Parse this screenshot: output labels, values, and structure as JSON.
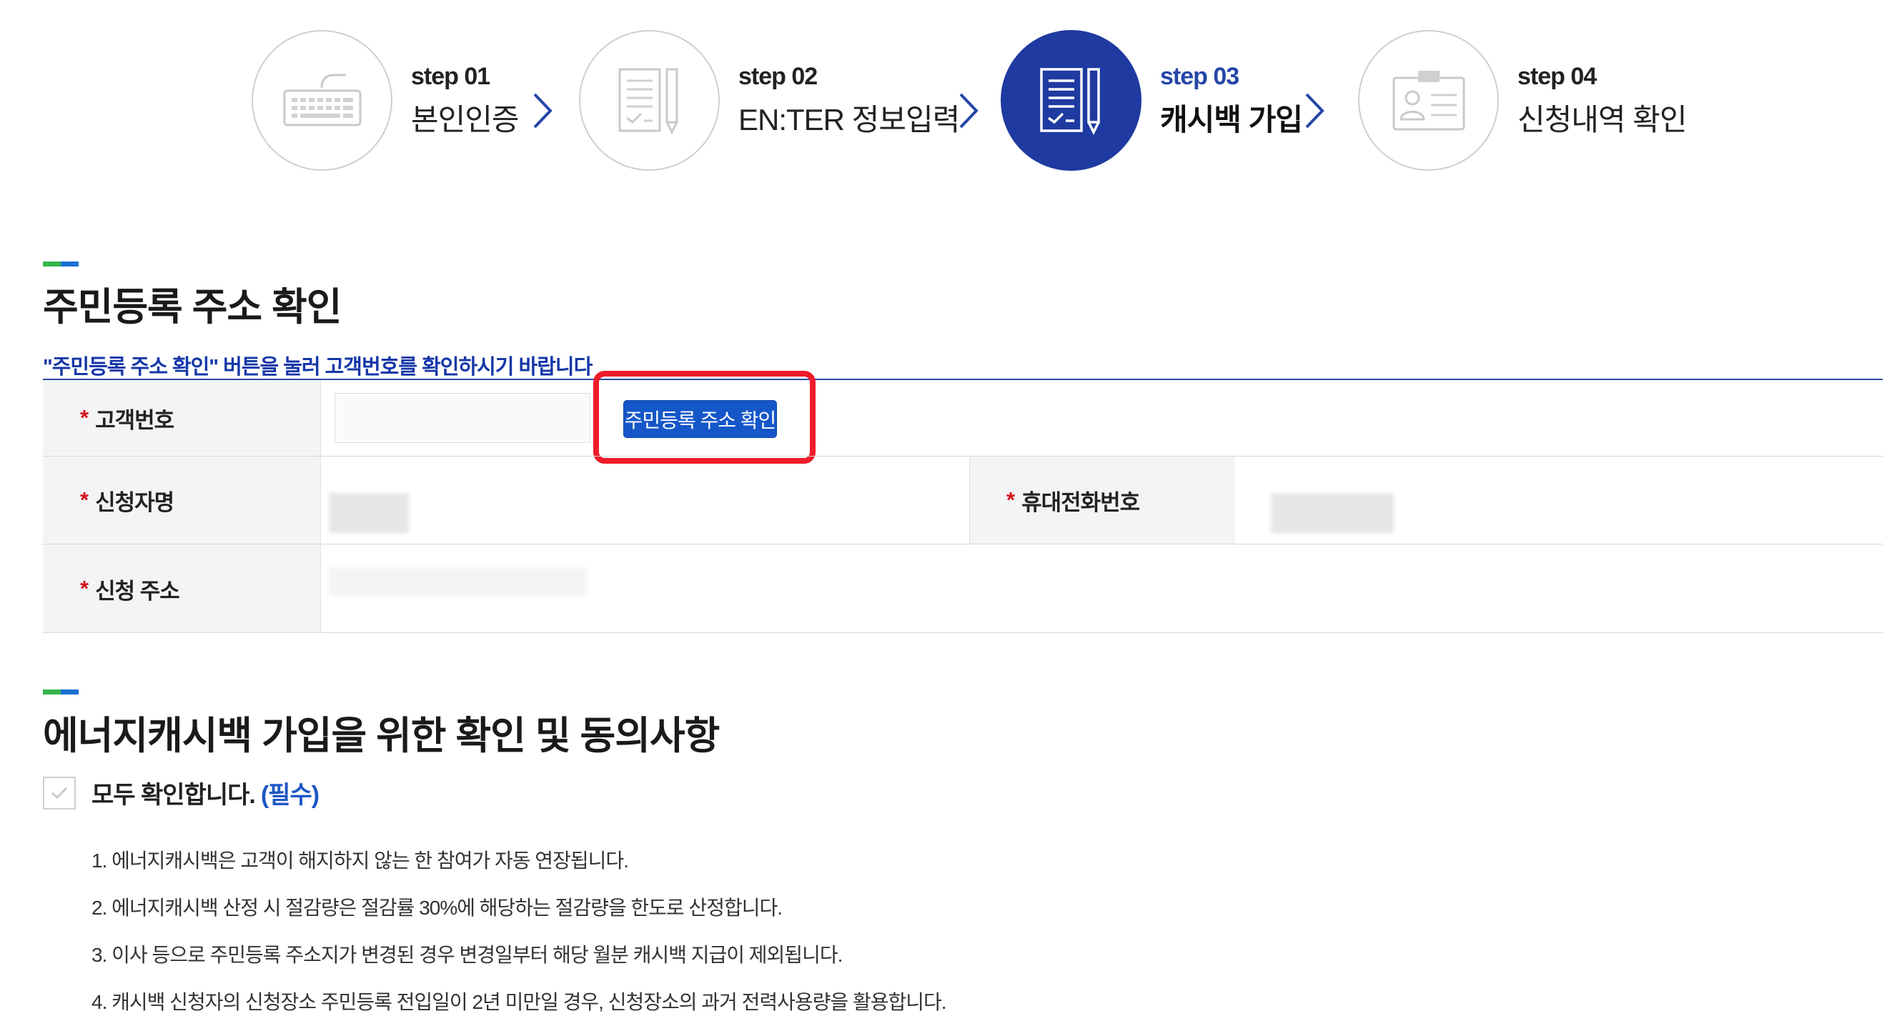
{
  "steps": [
    {
      "num": "step 01",
      "label": "본인인증",
      "icon": "keyboard-icon",
      "active": false
    },
    {
      "num": "step 02",
      "label": "EN:TER 정보입력",
      "icon": "document-pencil-icon",
      "active": false
    },
    {
      "num": "step 03",
      "label": "캐시백 가입",
      "icon": "document-check-pencil-icon",
      "active": true
    },
    {
      "num": "step 04",
      "label": "신청내역 확인",
      "icon": "id-card-icon",
      "active": false
    }
  ],
  "address_section": {
    "title": "주민등록 주소 확인",
    "notice": "\"주민등록 주소 확인\" 버튼을 눌러 고객번호를 확인하시기 바랍니다",
    "customer_no_label": "고객번호",
    "customer_no_value": "",
    "confirm_button": "주민등록 주소 확인",
    "applicant_name_label": "신청자명",
    "phone_label": "휴대전화번호",
    "address_label": "신청 주소",
    "required_mark": "*"
  },
  "agreement_section": {
    "title": "에너지캐시백 가입을 위한 확인 및 동의사항",
    "check_all_label": "모두 확인합니다.",
    "check_all_required": "(필수)",
    "terms": [
      "1. 에너지캐시백은 고객이 해지하지 않는 한 참여가 자동 연장됩니다.",
      "2. 에너지캐시백 산정 시 절감량은 절감률 30%에 해당하는 절감량을 한도로 산정합니다.",
      "3. 이사 등으로 주민등록 주소지가 변경된 경우 변경일부터 해당 월분 캐시백 지급이 제외됩니다.",
      "4. 캐시백 신청자의 신청장소 주민등록 전입일이 2년 미만일 경우, 신청장소의 과거 전력사용량을 활용합니다."
    ]
  },
  "colors": {
    "active_step": "#1f3aa0",
    "button": "#1557c9",
    "highlight": "#ee1b2b",
    "notice_text": "#1537a8",
    "required": "#d1121e"
  }
}
